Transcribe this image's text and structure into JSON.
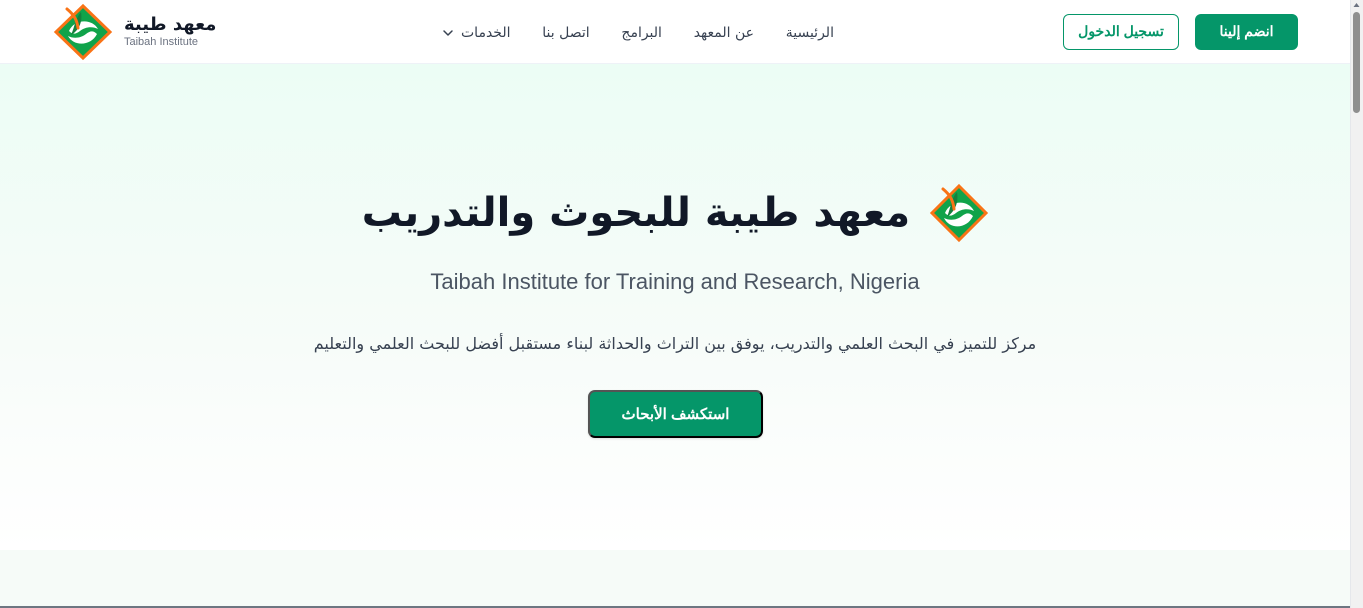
{
  "brand": {
    "name_ar": "معهد طيبة",
    "name_en": "Taibah Institute",
    "logo_icon": "taibah-logo-icon",
    "colors": {
      "green": "#059669",
      "logo_green": "#10a34a",
      "logo_orange": "#f97316"
    }
  },
  "nav": {
    "items": [
      {
        "label": "الخدمات",
        "icon": "chevron-down-icon"
      },
      {
        "label": "اتصل بنا"
      },
      {
        "label": "البرامج"
      },
      {
        "label": "عن المعهد"
      },
      {
        "label": "الرئيسية"
      }
    ]
  },
  "actions": {
    "login_label": "تسجيل الدخول",
    "join_label": "انضم إلينا"
  },
  "hero": {
    "title": "معهد طيبة للبحوث والتدريب",
    "subtitle": "Taibah Institute for Training and Research, Nigeria",
    "description": "مركز للتميز في البحث العلمي والتدريب، يوفق بين التراث والحداثة لبناء مستقبل أفضل للبحث العلمي والتعليم",
    "button_label": "استكشف الأبحاث",
    "background_color": "#ecfdf5"
  },
  "scrollbar": {
    "position_percent": 0
  }
}
